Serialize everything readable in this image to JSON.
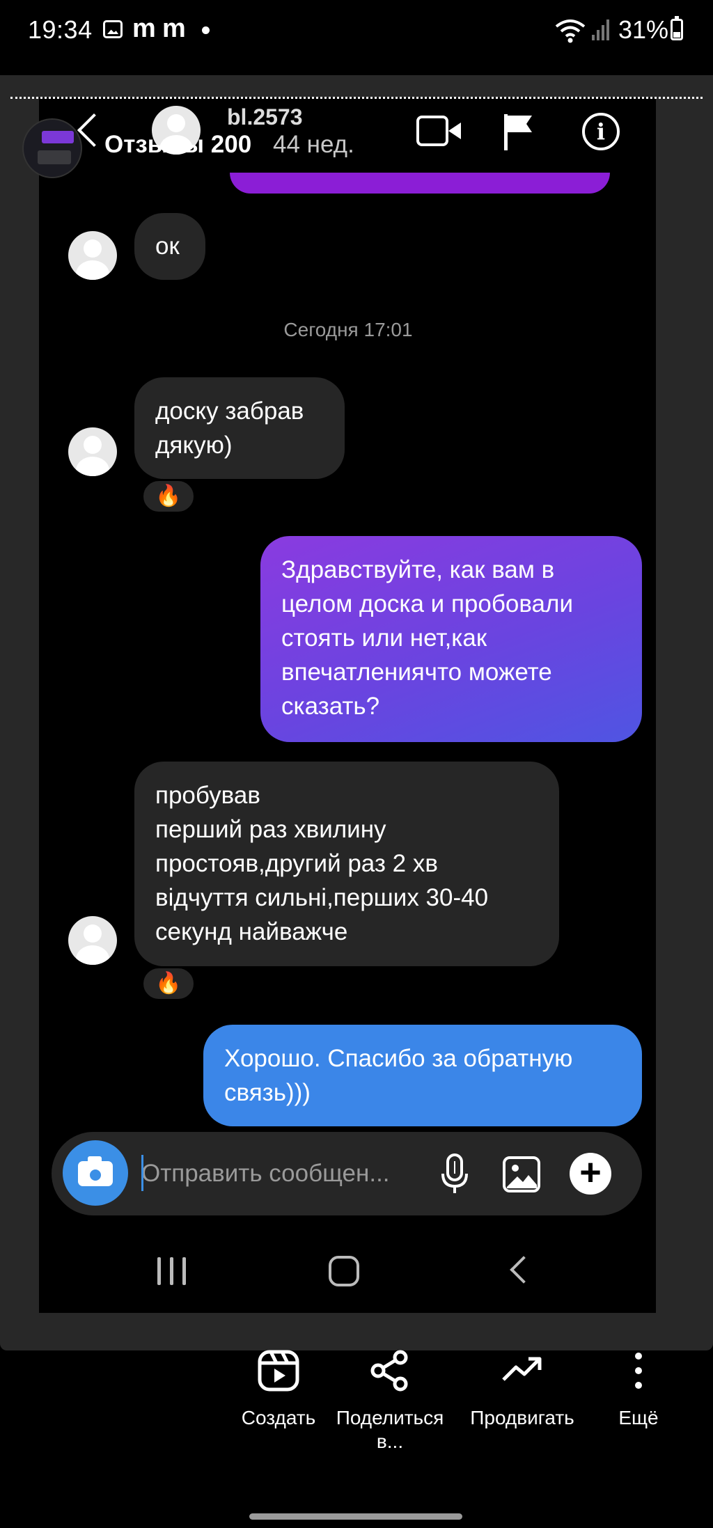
{
  "status_bar": {
    "time": "19:34",
    "notif_letters": [
      "m",
      "m"
    ],
    "battery": "31%"
  },
  "story": {
    "title": "Отзывы 200",
    "age": "44 нед."
  },
  "chat": {
    "username": "bl.2573",
    "input_placeholder": "Отправить сообщен...",
    "messages": [
      {
        "from": "them",
        "text": "ок"
      },
      {
        "type": "timestamp",
        "text": "Сегодня 17:01"
      },
      {
        "from": "them",
        "text": "доску забрав\nдякую)",
        "reaction": "🔥"
      },
      {
        "from": "me",
        "text": "Здравствуйте, как вам в\nцелом доска и пробовали\nстоять или нет,как\nвпечатлениячто можете\nсказать?"
      },
      {
        "from": "them",
        "text": "пробував\nперший раз хвилину\nпростояв,другий раз 2 хв\nвідчуття сильні,перших 30-40\nсекунд найважче",
        "reaction": "🔥"
      },
      {
        "from": "me",
        "text": "Хорошо. Спасибо за обратную\nсвязь)))"
      }
    ]
  },
  "actions": [
    {
      "label": "Создать",
      "icon": "reels-icon"
    },
    {
      "label": "Поделиться\nв...",
      "icon": "share-icon"
    },
    {
      "label": "Продвигать",
      "icon": "trending-icon"
    },
    {
      "label": "Ещё",
      "icon": "more-icon"
    }
  ],
  "colors": {
    "bubble_in": "#262626",
    "bubble_out_purple": "#6a44e0",
    "bubble_out_blue": "#3b86e8",
    "accent": "#3b8fe6"
  }
}
